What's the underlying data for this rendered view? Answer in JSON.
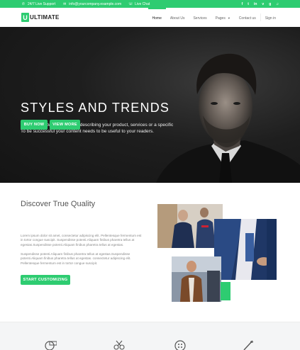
{
  "topbar": {
    "support": "24/7 Live Support",
    "email": "info@yourcompany.example.com",
    "chat": "Live Chat",
    "social": [
      "f",
      "t",
      "in",
      "v",
      "g",
      "♫"
    ]
  },
  "nav": {
    "logo_letter": "U",
    "logo_text": "ULTIMATE",
    "items": [
      "Home",
      "About Us",
      "Services",
      "Pages",
      "Contact us",
      "Sign in"
    ],
    "active": "Home"
  },
  "hero": {
    "title": "STYLES AND TRENDS",
    "text": "Write one or two paragraphs describing your product, services or a specific To be successful your content needs to be useful to your readers.",
    "buy_label": "BUY NOW",
    "more_label": "VIEW MORE"
  },
  "quality": {
    "title": "Discover True Quality",
    "para1": "Lorem ipsum dolor sit amet, consectetur adipiscing elit. Pellentesque fermentum est in tortor congue suscipit. Suspendisse potenti.Aliquam finibus pharetra tellus at egestas.Suspendisse potenti.Aliquam finibus pharetra tellus at egestas.",
    "para2": "Suspendisse potenti.Aliquam finibus pharetra tellus at egestas.Suspendisse potenti.Aliquam finibus pharetra tellus at egestas. consectetur adipiscing elit. Pellentesque fermentum est in tortor congue suscipit.",
    "cta_label": "START CUSTOMIZING"
  },
  "colors": {
    "accent": "#2ecc71",
    "hero_bg": "#1d1d1d"
  }
}
